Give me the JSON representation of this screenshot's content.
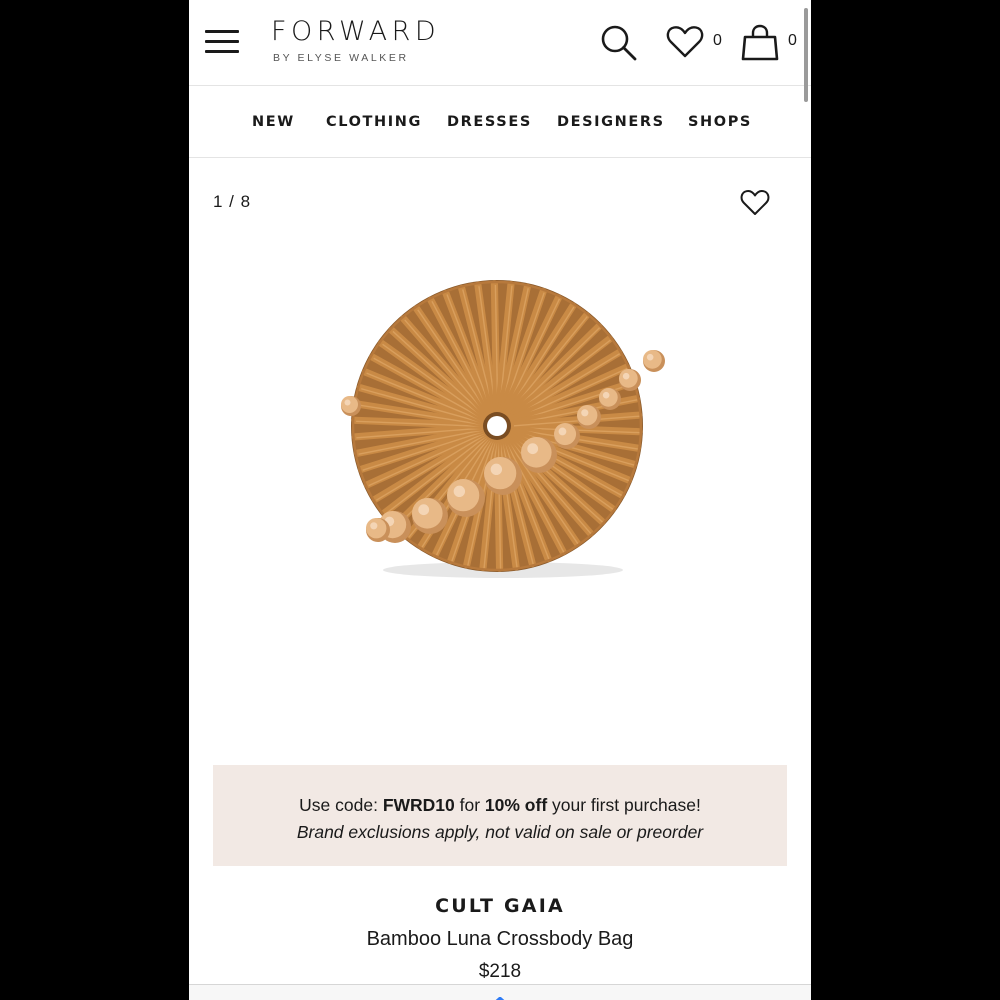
{
  "header": {
    "logo_main": "FORWARD",
    "logo_sub": "BY ELYSE WALKER",
    "wishlist_count": "0",
    "bag_count": "0",
    "icons": [
      "menu-icon",
      "search-icon",
      "heart-icon",
      "bag-icon"
    ]
  },
  "nav": {
    "items": [
      "NEW",
      "CLOTHING",
      "DRESSES",
      "DESIGNERS",
      "SHOPS"
    ]
  },
  "gallery": {
    "counter": "1 / 8"
  },
  "promo": {
    "prefix": "Use code: ",
    "code": "FWRD10",
    "middle": " for ",
    "discount": "10% off",
    "suffix": " your first purchase!",
    "disclaimer": "Brand exclusions apply, not valid on sale or preorder"
  },
  "product": {
    "brand": "CULT GAIA",
    "name": "Bamboo Luna Crossbody Bag",
    "price": "$218"
  },
  "colors": {
    "text": "#1a1a1a",
    "promo_bg": "#f2e9e4",
    "bamboo": "#c98a45",
    "bead": "#e8b987"
  }
}
